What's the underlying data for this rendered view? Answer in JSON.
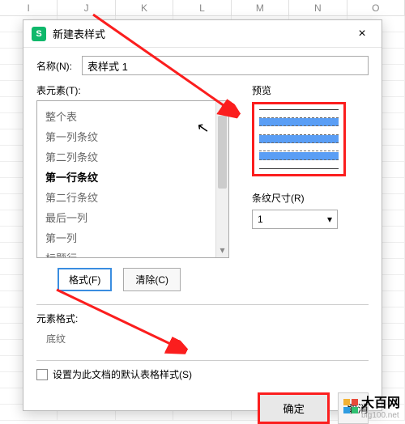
{
  "columns": [
    "I",
    "J",
    "K",
    "L",
    "M",
    "N",
    "O"
  ],
  "dialog": {
    "title": "新建表样式",
    "close_aria": "×",
    "name_label": "名称(N):",
    "name_value": "表样式 1",
    "table_elem_label": "表元素(T):",
    "list": [
      {
        "label": "整个表"
      },
      {
        "label": "第一列条纹"
      },
      {
        "label": "第二列条纹"
      },
      {
        "label": "第一行条纹",
        "selected": true
      },
      {
        "label": "第二行条纹"
      },
      {
        "label": "最后一列"
      },
      {
        "label": "第一列"
      },
      {
        "label": "标题行"
      }
    ],
    "format_btn": "格式(F)",
    "clear_btn": "清除(C)",
    "preview_label": "预览",
    "stripe_size_label": "条纹尺寸(R)",
    "stripe_size_value": "1",
    "elem_format_label": "元素格式:",
    "shading_label": "底纹",
    "set_default_label": "设置为此文档的默认表格样式(S)",
    "ok": "确定",
    "cancel": "取消"
  },
  "watermark": {
    "brand": "大百网",
    "url": "big100.net"
  }
}
